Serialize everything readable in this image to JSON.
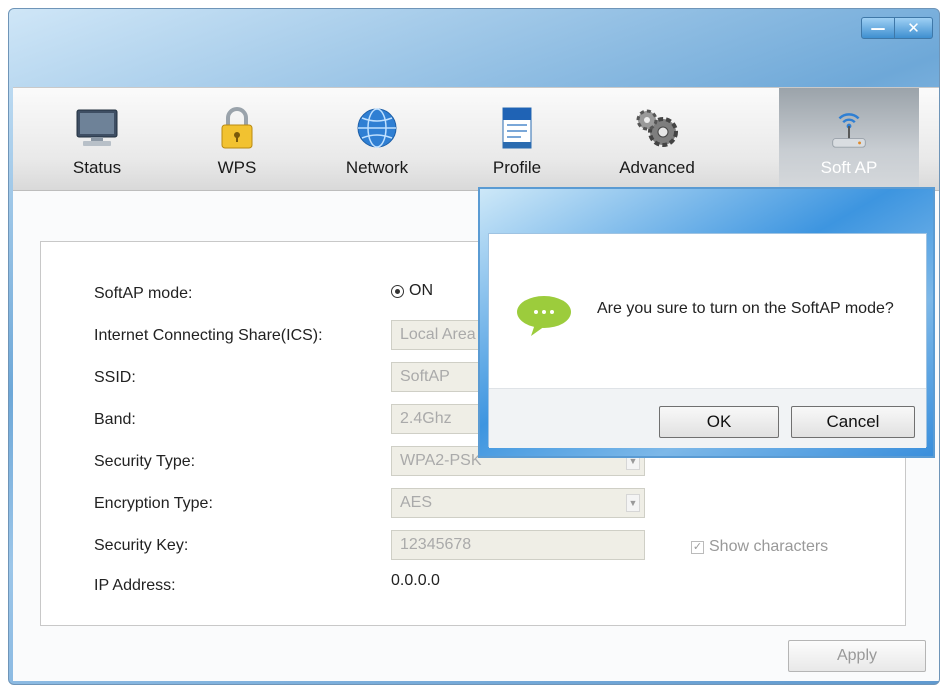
{
  "window": {
    "minimize_glyph": "—",
    "close_glyph": "✕"
  },
  "toolbar": {
    "tabs": [
      {
        "label": "Status",
        "icon": "monitor-icon"
      },
      {
        "label": "WPS",
        "icon": "padlock-icon"
      },
      {
        "label": "Network",
        "icon": "globe-icon"
      },
      {
        "label": "Profile",
        "icon": "document-icon"
      },
      {
        "label": "Advanced",
        "icon": "gears-icon"
      },
      {
        "label": "Soft AP",
        "icon": "wireless-antenna-icon",
        "active": true
      }
    ]
  },
  "form": {
    "softap_mode": {
      "label": "SoftAP mode:",
      "option": "ON"
    },
    "ics": {
      "label": "Internet Connecting Share(ICS):",
      "value": "Local Area"
    },
    "ssid": {
      "label": "SSID:",
      "value": "SoftAP"
    },
    "band": {
      "label": "Band:",
      "value": "2.4Ghz"
    },
    "security_type": {
      "label": "Security Type:",
      "value": "WPA2-PSK"
    },
    "encryption_type": {
      "label": "Encryption Type:",
      "value": "AES"
    },
    "security_key": {
      "label": "Security Key:",
      "value": "12345678"
    },
    "show_characters": {
      "label": "Show characters",
      "checked": true
    },
    "ip_address": {
      "label": "IP Address:",
      "value": "0.0.0.0"
    },
    "apply_label": "Apply"
  },
  "dialog": {
    "icon": "chat-bubble-icon",
    "message": "Are you sure to turn on the SoftAP mode?",
    "ok_label": "OK",
    "cancel_label": "Cancel"
  },
  "colors": {
    "accent_blue": "#3d95e0",
    "bubble_green": "#9ccc3c",
    "disabled_field": "#efeee6"
  }
}
